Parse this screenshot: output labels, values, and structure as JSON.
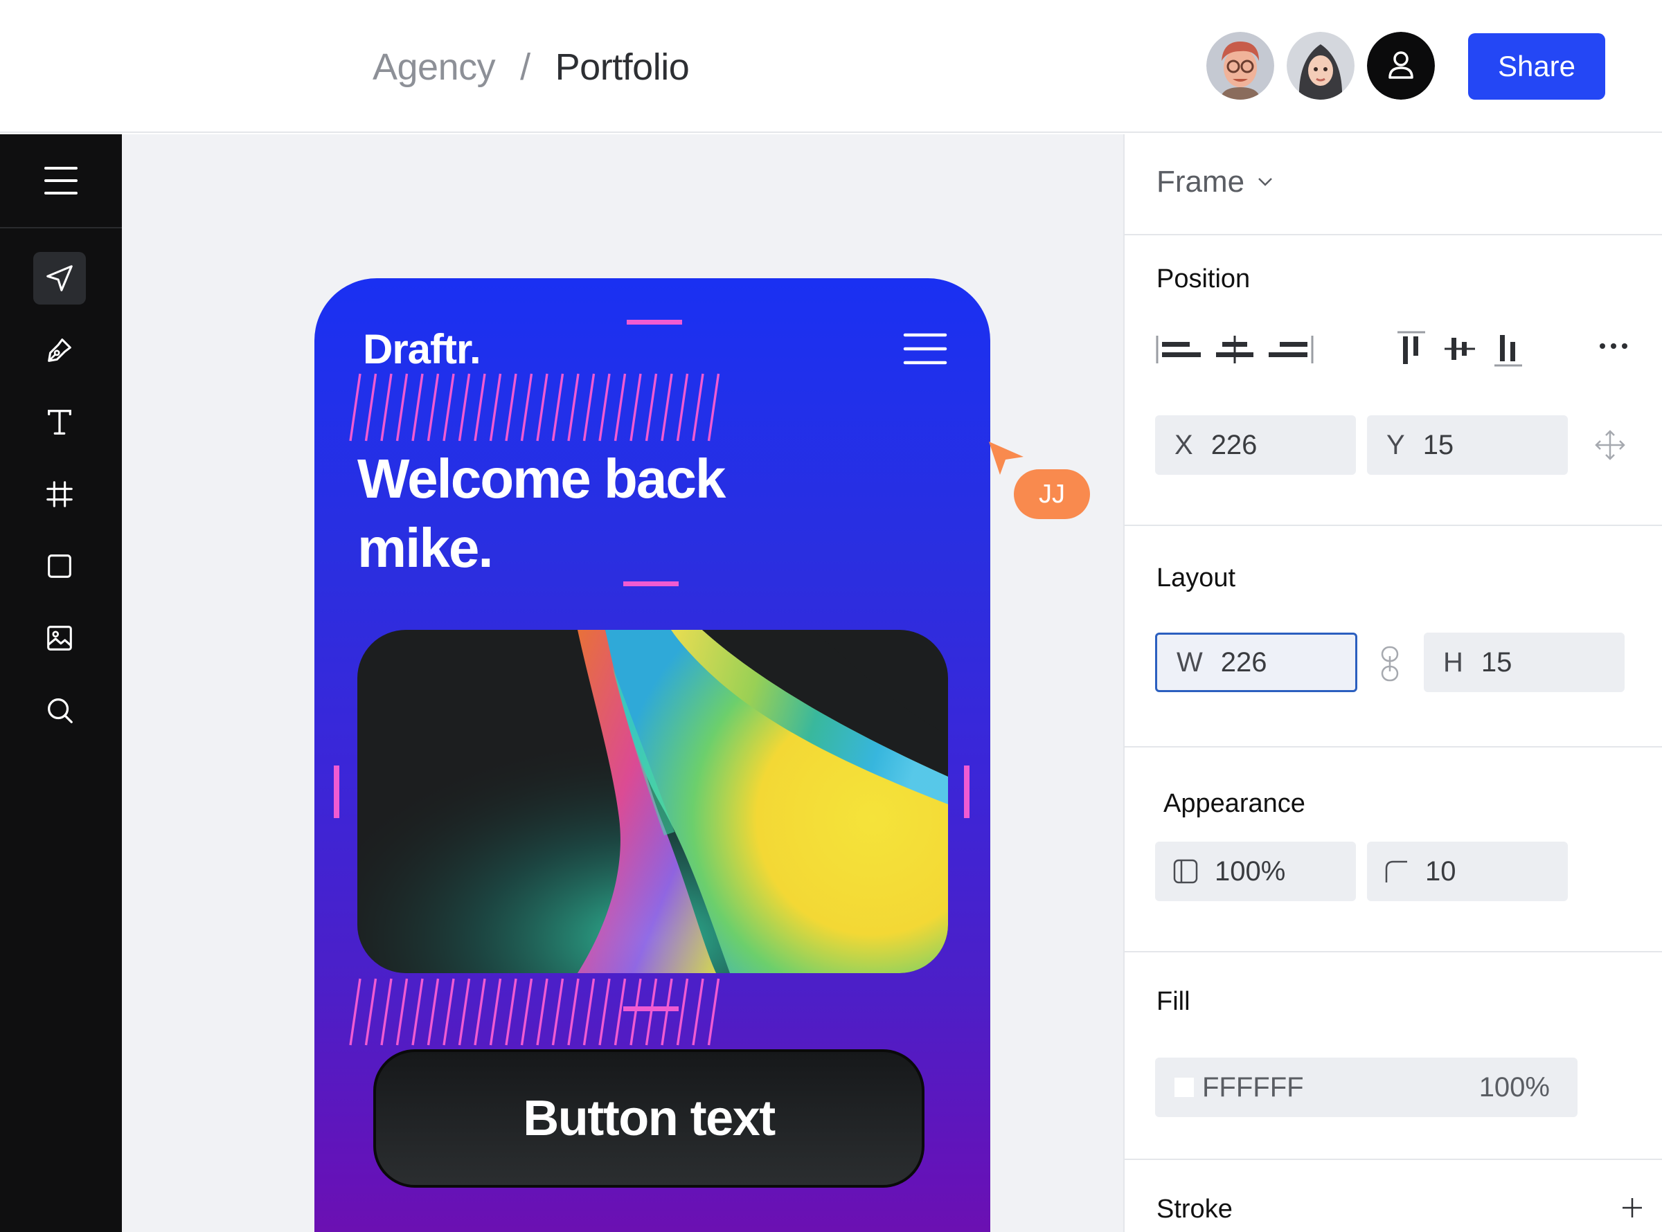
{
  "header": {
    "breadcrumb": {
      "parent": "Agency",
      "separator": "/",
      "current": "Portfolio"
    },
    "share_label": "Share"
  },
  "toolbar": {
    "tools": [
      "menu-icon",
      "cursor-icon",
      "pen-icon",
      "text-icon",
      "frame-icon",
      "rectangle-icon",
      "image-icon",
      "search-icon"
    ],
    "active": "cursor-icon"
  },
  "canvas": {
    "brand": "Draftr.",
    "headline_line1": "Welcome back",
    "headline_line2": "mike.",
    "button_text": "Button text",
    "cursor_label": "JJ"
  },
  "panel": {
    "frame_dropdown": "Frame",
    "position": {
      "title": "Position",
      "x_label": "X",
      "x_value": "226",
      "y_label": "Y",
      "y_value": "15"
    },
    "layout": {
      "title": "Layout",
      "w_label": "W",
      "w_value": "226",
      "h_label": "H",
      "h_value": "15"
    },
    "appearance": {
      "title": "Appearance",
      "opacity": "100%",
      "radius": "10"
    },
    "fill": {
      "title": "Fill",
      "hex": "FFFFFF",
      "opacity": "100%"
    },
    "stroke": {
      "title": "Stroke"
    }
  },
  "colors": {
    "accent": "#2447f5",
    "cursor": "#f98a4e",
    "guide": "#f05bd2"
  }
}
